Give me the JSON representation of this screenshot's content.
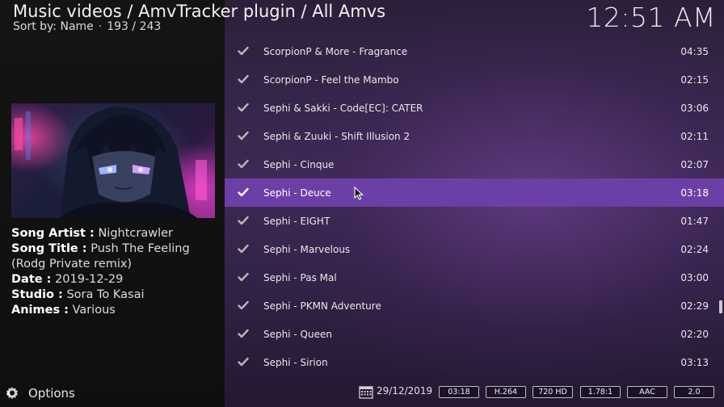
{
  "header": {
    "breadcrumb": "Music videos / AmvTracker plugin / All Amvs",
    "sort_label": "Sort by: Name",
    "separator": "·",
    "position": "193 / 243",
    "clock": "12:51 AM"
  },
  "details": {
    "artist_key": "Song Artist :",
    "artist_value": "Nightcrawler",
    "title_key": "Song Title :",
    "title_value": "Push The Feeling (Rodg Private remix)",
    "date_key": "Date :",
    "date_value": "2019-12-29",
    "studio_key": "Studio :",
    "studio_value": "Sora To Kasai",
    "animes_key": "Animes :",
    "animes_value": "Various"
  },
  "options": {
    "label": "Options",
    "icon": "gear-arrow-icon"
  },
  "list": {
    "selected_index": 5,
    "items": [
      {
        "title": "ScorpionP & More - Fragrance",
        "duration": "04:35"
      },
      {
        "title": "ScorpionP - Feel the Mambo",
        "duration": "02:15"
      },
      {
        "title": "Sephi & Sakki - Code[EC]: CATER",
        "duration": "03:06"
      },
      {
        "title": "Sephi & Zuuki - Shift Illusion 2",
        "duration": "02:11"
      },
      {
        "title": "Sephi - Cinque",
        "duration": "02:07"
      },
      {
        "title": "Sephi - Deuce",
        "duration": "03:18"
      },
      {
        "title": "Sephi - EIGHT",
        "duration": "01:47"
      },
      {
        "title": "Sephi - Marvelous",
        "duration": "02:24"
      },
      {
        "title": "Sephi - Pas Mal",
        "duration": "03:00"
      },
      {
        "title": "Sephi - PKMN Adventure",
        "duration": "02:29"
      },
      {
        "title": "Sephi - Queen",
        "duration": "02:20"
      },
      {
        "title": "Sephi - Sirion",
        "duration": "03:13"
      }
    ]
  },
  "footer": {
    "date": "29/12/2019",
    "badges": [
      "03:18",
      "H.264",
      "720 HD",
      "1.78:1",
      "AAC",
      "2.0"
    ]
  },
  "colors": {
    "accent": "#6c3fa6",
    "panel_bg": "#141414",
    "list_bg": "#3e2a56"
  }
}
